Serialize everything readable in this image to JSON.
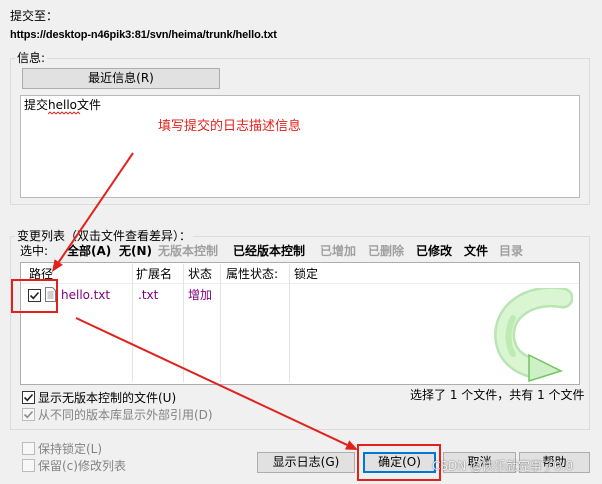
{
  "title_block": {
    "commit_to_label": "提交至：",
    "url": "https://desktop-n46pik3:81/svn/heima/trunk/hello.txt"
  },
  "message": {
    "group_title": "信息:",
    "recent_button": "最近信息(R)",
    "text": "提交hello文件"
  },
  "annotations": {
    "note": "填写提交的日志描述信息",
    "color": "#e3211b"
  },
  "changes": {
    "group_title": "变更列表（双击文件查看差异）：",
    "select_label": "选中:",
    "filters": [
      {
        "label": "全部(A)",
        "enabled": true
      },
      {
        "label": "无(N)",
        "enabled": true
      },
      {
        "label": "无版本控制",
        "enabled": false
      },
      {
        "label": "已经版本控制",
        "enabled": true
      },
      {
        "label": "已增加",
        "enabled": false
      },
      {
        "label": "已删除",
        "enabled": false
      },
      {
        "label": "已修改",
        "enabled": true
      },
      {
        "label": "文件",
        "enabled": true
      },
      {
        "label": "目录",
        "enabled": false
      }
    ],
    "columns": [
      "路径",
      "扩展名",
      "状态",
      "属性状态:",
      "锁定"
    ],
    "rows": [
      {
        "checked": true,
        "icon": "text-file-icon",
        "path": "hello.txt",
        "extension": ".txt",
        "status": "增加"
      }
    ],
    "file_color": "#800080",
    "show_unversioned": {
      "label": "显示无版本控制的文件(U)",
      "checked": true,
      "enabled": true
    },
    "show_externals": {
      "label": "从不同的版本库显示外部引用(D)",
      "checked": true,
      "enabled": false
    },
    "selection_summary": "选择了 1 个文件，共有 1 个文件"
  },
  "options": {
    "keep_locks": {
      "label": "保持锁定(L)",
      "checked": false,
      "enabled": false
    },
    "keep_changelists": {
      "label": "保留(c)修改列表",
      "checked": false,
      "enabled": false
    }
  },
  "buttons": {
    "show_log": "显示日志(G)",
    "ok": "确定(O)",
    "cancel": "取消",
    "help": "帮助"
  },
  "watermark": "CSDN @快乐就完事了0.0"
}
